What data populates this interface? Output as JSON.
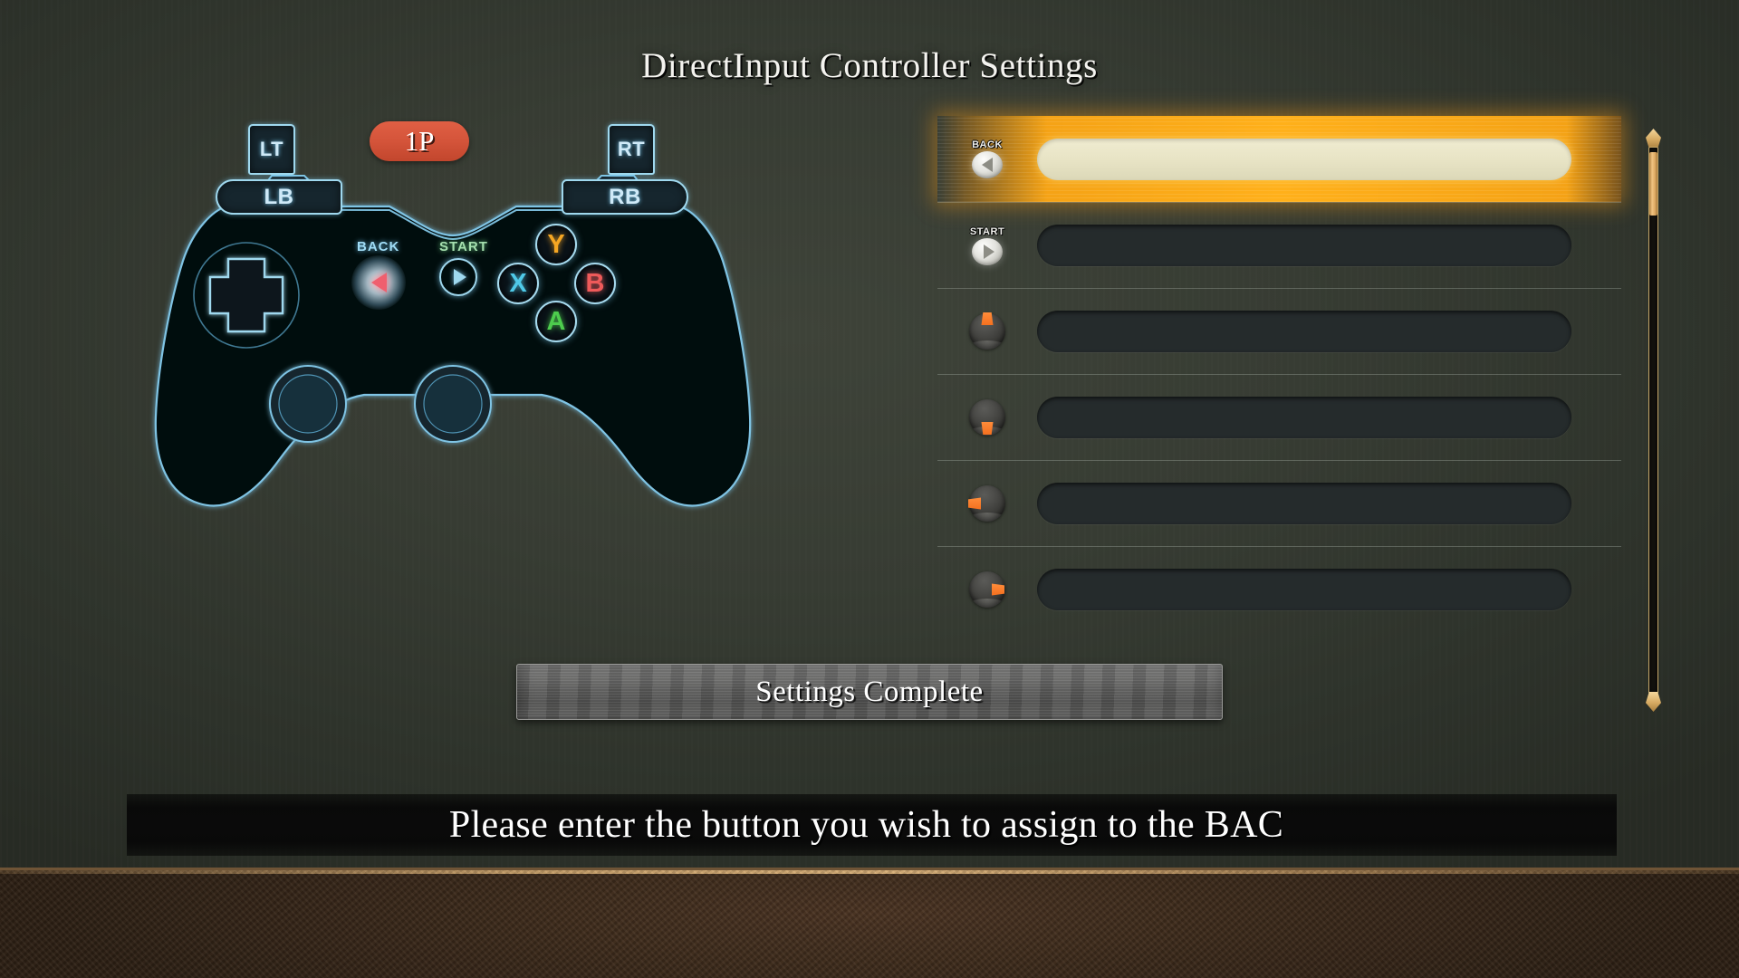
{
  "title": "DirectInput Controller Settings",
  "gamepad": {
    "player_badge": "1P",
    "left_trigger": "LT",
    "right_trigger": "RT",
    "left_bumper": "LB",
    "right_bumper": "RB",
    "back_label": "BACK",
    "start_label": "START",
    "face_buttons": [
      {
        "label": "Y",
        "color": "#f5a623"
      },
      {
        "label": "X",
        "color": "#4fc9e8"
      },
      {
        "label": "B",
        "color": "#ef5a5a"
      },
      {
        "label": "A",
        "color": "#4dcc4d"
      }
    ],
    "accent_line_color": "#7fc4e4",
    "body_color": "#060a0d"
  },
  "bindings": {
    "rows": [
      {
        "icon": "back-button-icon",
        "mini_label": "BACK",
        "value": "",
        "selected": true
      },
      {
        "icon": "start-button-icon",
        "mini_label": "START",
        "value": "",
        "selected": false
      },
      {
        "icon": "stick-up-icon",
        "mini_label": "",
        "value": "",
        "selected": false
      },
      {
        "icon": "stick-down-icon",
        "mini_label": "",
        "value": "",
        "selected": false
      },
      {
        "icon": "stick-left-icon",
        "mini_label": "",
        "value": "",
        "selected": false
      },
      {
        "icon": "stick-right-icon",
        "mini_label": "",
        "value": "",
        "selected": false
      }
    ],
    "highlight_color": "#ffab1a",
    "field_selected_color": "#ebe7c8",
    "field_color": "#252b2c"
  },
  "scrollbar": {
    "thumb_color": "#e2ae67",
    "track_color": "#14120e"
  },
  "complete_button": {
    "label": "Settings Complete"
  },
  "message_bar": {
    "text": "Please enter the button you wish to assign to the BAC"
  }
}
